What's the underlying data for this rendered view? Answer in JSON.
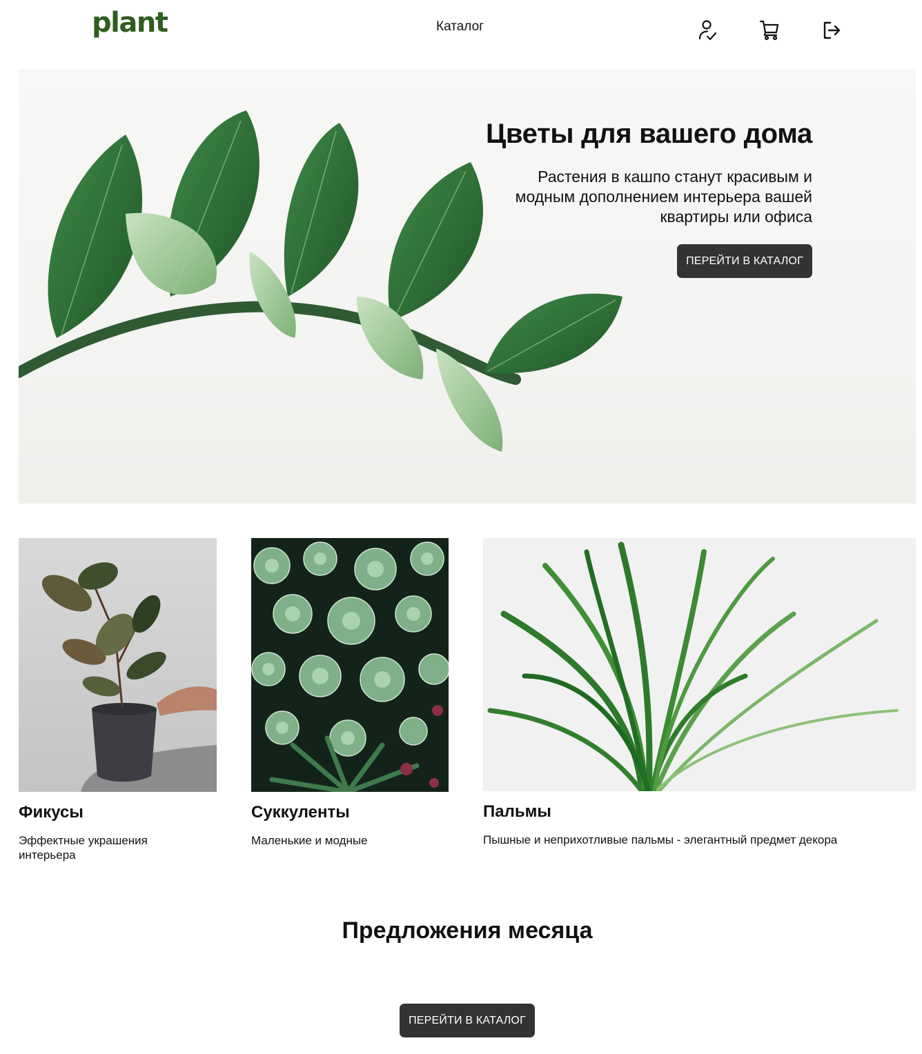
{
  "header": {
    "logo": "plant",
    "nav_catalog": "Каталог",
    "icons": [
      "user-check-icon",
      "cart-icon",
      "logout-icon"
    ]
  },
  "hero": {
    "title": "Цветы для вашего дома",
    "subtitle": "Растения в кашпо станут красивым и модным дополнением интерьера вашей квартиры или офиса",
    "button": "ПЕРЕЙТИ В КАТАЛОГ"
  },
  "categories": [
    {
      "title": "Фикусы",
      "description": "Эффектные украшения интерьера"
    },
    {
      "title": "Суккуленты",
      "description": "Маленькие и модные"
    },
    {
      "title": "Пальмы",
      "description": "Пышные и неприхотливые пальмы - элегантный предмет декора"
    }
  ],
  "offers": {
    "title": "Предложения месяца",
    "button": "ПЕРЕЙТИ В КАТАЛОГ"
  },
  "colors": {
    "brand": "#2f5d1f",
    "button_bg": "#333333",
    "button_text": "#ffffff",
    "leaf_dark": "#2f6b36",
    "leaf_light": "#9cc793"
  }
}
